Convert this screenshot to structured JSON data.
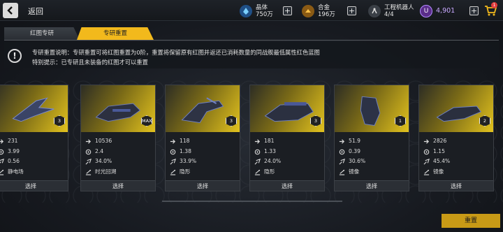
{
  "header": {
    "back_label": "返回",
    "resources": [
      {
        "name": "晶体",
        "value": "750万"
      },
      {
        "name": "合金",
        "value": "196万"
      },
      {
        "name": "工程机器人",
        "value": "4/4"
      }
    ],
    "currency": "4,901",
    "cart_badge": "1"
  },
  "tabs": [
    {
      "label": "红图专研",
      "active": false
    },
    {
      "label": "专研重置",
      "active": true
    }
  ],
  "info": {
    "line1": "专研重置说明：专研重置可将红图重置为0阶，重置将保留原有红图并返还已消耗数量的同战舰最低属性红色蓝图",
    "line2": "特别提示：已专研且未装备的红图才可以重置"
  },
  "cards": [
    {
      "star": "3",
      "stats": [
        "231",
        "3.99",
        "0.56"
      ],
      "ability": "静电场",
      "select": "选择"
    },
    {
      "star": "MAX",
      "stats": [
        "10536",
        "2.4",
        "34.0%"
      ],
      "ability": "时光回溯",
      "select": "选择"
    },
    {
      "star": "3",
      "stats": [
        "118",
        "1.38",
        "33.9%"
      ],
      "ability": "隐形",
      "select": "选择"
    },
    {
      "star": "3",
      "stats": [
        "181",
        "1.33",
        "24.0%"
      ],
      "ability": "隐形",
      "select": "选择"
    },
    {
      "star": "1",
      "stats": [
        "51.9",
        "0.39",
        "30.6%"
      ],
      "ability": "镜像",
      "select": "选择"
    },
    {
      "star": "2",
      "stats": [
        "2826",
        "1.15",
        "45.4%"
      ],
      "ability": "镜像",
      "select": "选择"
    }
  ],
  "reset_label": "重置",
  "colors": {
    "accent": "#f2b91c",
    "button": "#c89a16",
    "badge": "#e23b3b"
  }
}
